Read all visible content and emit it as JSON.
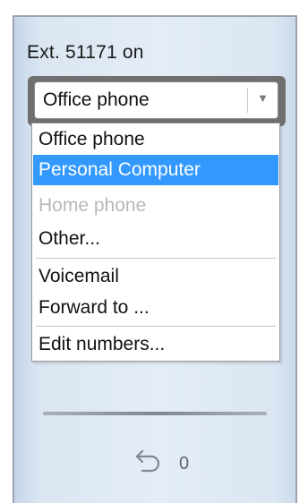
{
  "status": {
    "extension_label": "Ext. 51171 on"
  },
  "device_select": {
    "value": "Office phone"
  },
  "dropdown": {
    "items": [
      {
        "label": "Office phone",
        "state": "normal"
      },
      {
        "label": "Personal Computer",
        "state": "selected"
      },
      {
        "label": "Home phone",
        "state": "disabled"
      },
      {
        "label": "Other...",
        "state": "normal"
      },
      {
        "label": "Voicemail",
        "state": "normal"
      },
      {
        "label": "Forward to ...",
        "state": "normal"
      },
      {
        "label": "Edit numbers...",
        "state": "normal"
      }
    ]
  },
  "redial": {
    "icon": "undo-arrow-icon",
    "count": "0"
  },
  "colors": {
    "selection": "#3399ff",
    "panel": "#dbe6f2"
  }
}
